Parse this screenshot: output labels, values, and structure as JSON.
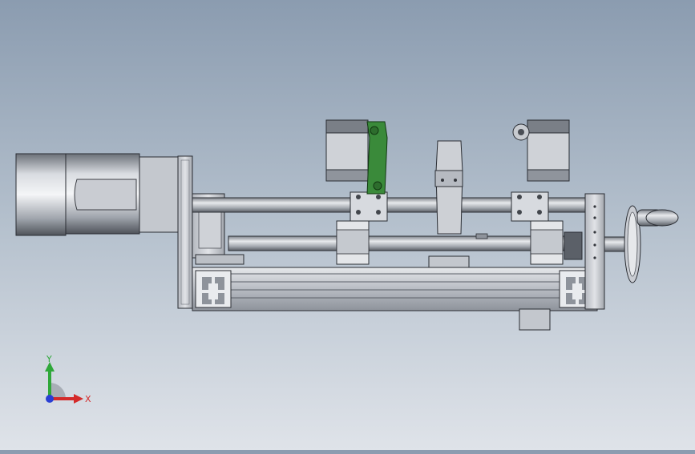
{
  "viewport": {
    "background_top": "#8b9cb0",
    "background_bottom": "#dfe3e9"
  },
  "model": {
    "parts": [
      "motor",
      "motor-flange",
      "frame-extrusion",
      "guide-rod-upper",
      "guide-rod-lower",
      "carriage-left",
      "carriage-right",
      "center-support",
      "green-link",
      "end-plate-right",
      "handwheel",
      "mount-block"
    ],
    "colors": {
      "metal_light": "#dcdfe4",
      "metal_mid": "#a9aeb6",
      "metal_dark": "#5b6068",
      "edge": "#2a2d33",
      "green_link": "#3a8a3a"
    }
  },
  "triad": {
    "x_label": "X",
    "y_label": "Y",
    "x_color": "#d42a2a",
    "y_color": "#2fa83a",
    "z_color": "#2a3fd4"
  }
}
